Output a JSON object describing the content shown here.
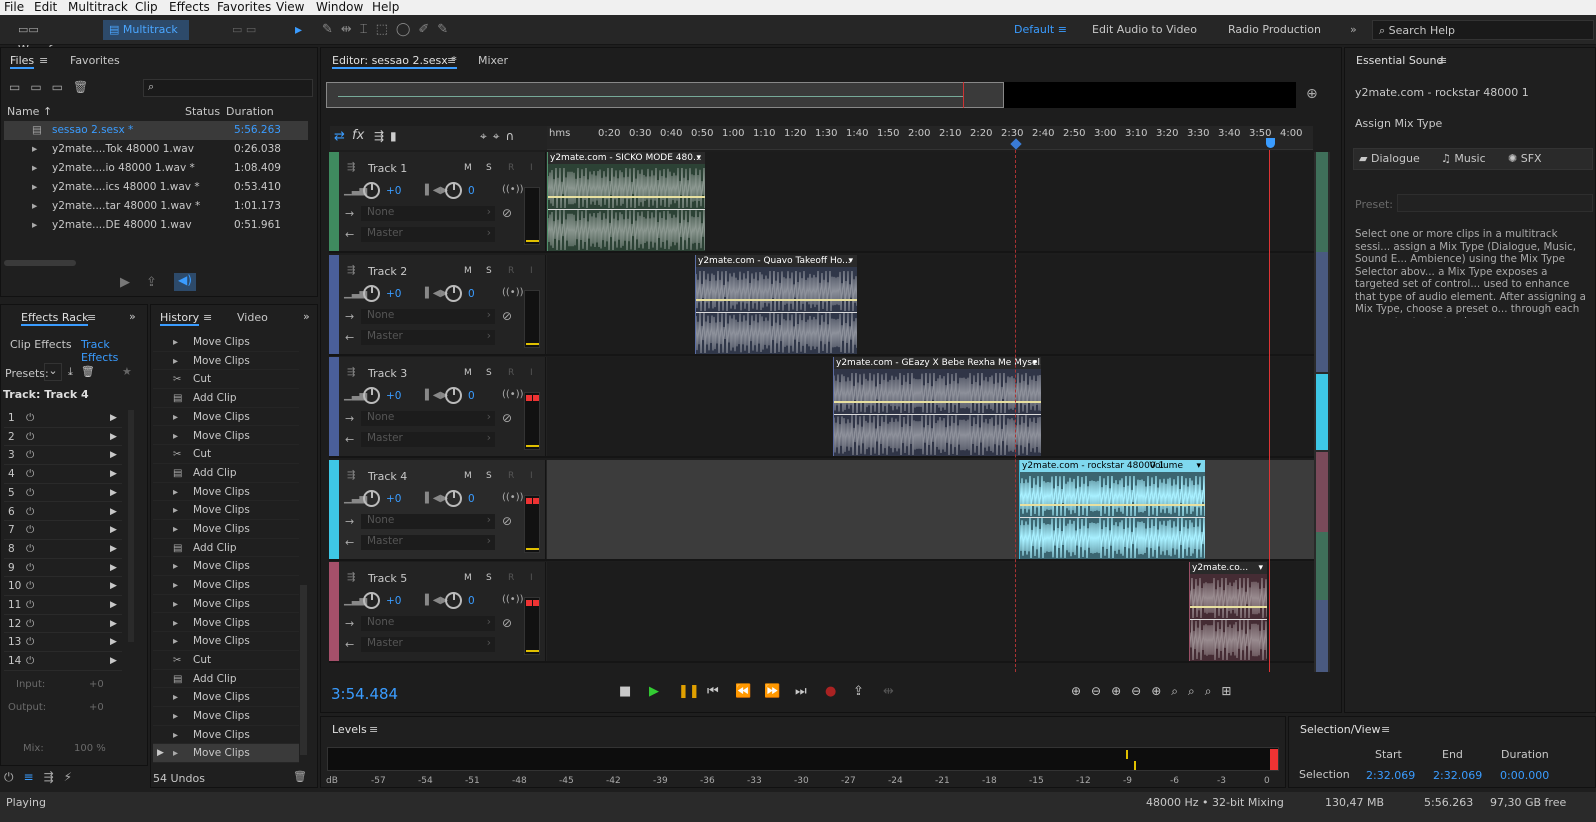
{
  "menu": [
    "File",
    "Edit",
    "Multitrack",
    "Clip",
    "Effects",
    "Favorites",
    "View",
    "Window",
    "Help"
  ],
  "toolbar": {
    "waveform": "Waveform",
    "multitrack": "Multitrack",
    "workspaces": [
      "Default",
      "Edit Audio to Video",
      "Radio Production"
    ],
    "search_help": "Search Help"
  },
  "files": {
    "tabs": [
      "Files",
      "Favorites"
    ],
    "columns": [
      "Name",
      "Status",
      "Duration"
    ],
    "rows": [
      {
        "name": "sessao 2.sesx *",
        "duration": "5:56.263"
      },
      {
        "name": "y2mate....Tok 48000 1.wav",
        "duration": "0:26.038"
      },
      {
        "name": "y2mate....io 48000 1.wav *",
        "duration": "1:08.409"
      },
      {
        "name": "y2mate....ics 48000 1.wav *",
        "duration": "0:53.410"
      },
      {
        "name": "y2mate....tar 48000 1.wav *",
        "duration": "1:01.173"
      },
      {
        "name": "y2mate....DE 48000 1.wav",
        "duration": "0:51.961"
      }
    ]
  },
  "effects": {
    "title": "Effects Rack",
    "tabs": [
      "Clip Effects",
      "Track Effects"
    ],
    "presets_label": "Presets:",
    "track_label": "Track: Track 4",
    "slots": [
      "1",
      "2",
      "3",
      "4",
      "5",
      "6",
      "7",
      "8",
      "9",
      "10",
      "11",
      "12",
      "13",
      "14"
    ],
    "input_label": "Input:",
    "output_label": "Output:",
    "input_val": "+0",
    "output_val": "+0",
    "mix_label": "Mix:",
    "mix_val": "100 %"
  },
  "history": {
    "tabs": [
      "History",
      "Video"
    ],
    "items": [
      "Move Clips",
      "Move Clips",
      "Cut",
      "Add Clip",
      "Move Clips",
      "Move Clips",
      "Cut",
      "Add Clip",
      "Move Clips",
      "Move Clips",
      "Move Clips",
      "Add Clip",
      "Move Clips",
      "Move Clips",
      "Move Clips",
      "Move Clips",
      "Move Clips",
      "Cut",
      "Add Clip",
      "Move Clips",
      "Move Clips",
      "Move Clips",
      "Move Clips"
    ],
    "undos": "54 Undos"
  },
  "editor": {
    "tab": "Editor: sessao 2.sesx *",
    "mixer": "Mixer",
    "ruler": [
      "hms",
      "0:20",
      "0:30",
      "0:40",
      "0:50",
      "1:00",
      "1:10",
      "1:20",
      "1:30",
      "1:40",
      "1:50",
      "2:00",
      "2:10",
      "2:20",
      "2:30",
      "2:40",
      "2:50",
      "3:00",
      "3:10",
      "3:20",
      "3:30",
      "3:40",
      "3:50",
      "4:00"
    ],
    "time": "3:54.484"
  },
  "tracks": [
    {
      "name": "Track 1",
      "vol": "+0",
      "pan": "0",
      "input": "None",
      "output": "Master",
      "color": "#3f8a5f",
      "clip": "y2mate.com - SICKO MODE 480...",
      "clip_color": "#4f8f6a"
    },
    {
      "name": "Track 2",
      "vol": "+0",
      "pan": "0",
      "input": "None",
      "output": "Master",
      "color": "#4a5f9a",
      "clip": "y2mate.com - Quavo  Takeoff  Ho...",
      "clip_color": "#5a6ea5"
    },
    {
      "name": "Track 3",
      "vol": "+0",
      "pan": "0",
      "input": "None",
      "output": "Master",
      "color": "#4a5f9a",
      "clip": "y2mate.com - GEazy X Bebe Rexha  Me Mysel...",
      "clip_color": "#5a6aa0"
    },
    {
      "name": "Track 4",
      "vol": "+0",
      "pan": "0",
      "input": "None",
      "output": "Master",
      "color": "#3ec7e6",
      "clip": "y2mate.com - rockstar 48000 1",
      "clip_extra": "Volume",
      "clip_color": "#3ab8d8"
    },
    {
      "name": "Track 5",
      "vol": "+0",
      "pan": "0",
      "input": "None",
      "output": "Master",
      "color": "#a5506a",
      "clip": "y2mate.co...",
      "clip_color": "#9a4f66"
    }
  ],
  "levels": {
    "title": "Levels",
    "ticks": [
      "dB",
      "-57",
      "-54",
      "-51",
      "-48",
      "-45",
      "-42",
      "-39",
      "-36",
      "-33",
      "-30",
      "-27",
      "-24",
      "-21",
      "-18",
      "-15",
      "-12",
      "-9",
      "-6",
      "-3",
      "0"
    ]
  },
  "selection": {
    "title": "Selection/View",
    "cols": [
      "Start",
      "End",
      "Duration"
    ],
    "row_label": "Selection",
    "start": "2:32.069",
    "end": "2:32.069",
    "duration": "0:00.000"
  },
  "essential": {
    "title": "Essential Sound",
    "clip": "y2mate.com - rockstar 48000 1",
    "assign": "Assign Mix Type",
    "types": [
      "Dialogue",
      "Music",
      "SFX"
    ],
    "preset": "Preset:",
    "help": "Select one or more clips in a multitrack sessi... assign a Mix Type (Dialogue, Music, Sound E... Ambience) using the Mix Type Selector abov... a Mix Type exposes a targeted set of control... used to enhance that type of audio element. After assigning a Mix Type, choose a preset o... through each parameter to customize your r..."
  },
  "status": {
    "state": "Playing",
    "rate": "48000 Hz • 32-bit Mixing",
    "mem": "130,47 MB",
    "dur": "5:56.263",
    "free": "97,30 GB free"
  }
}
